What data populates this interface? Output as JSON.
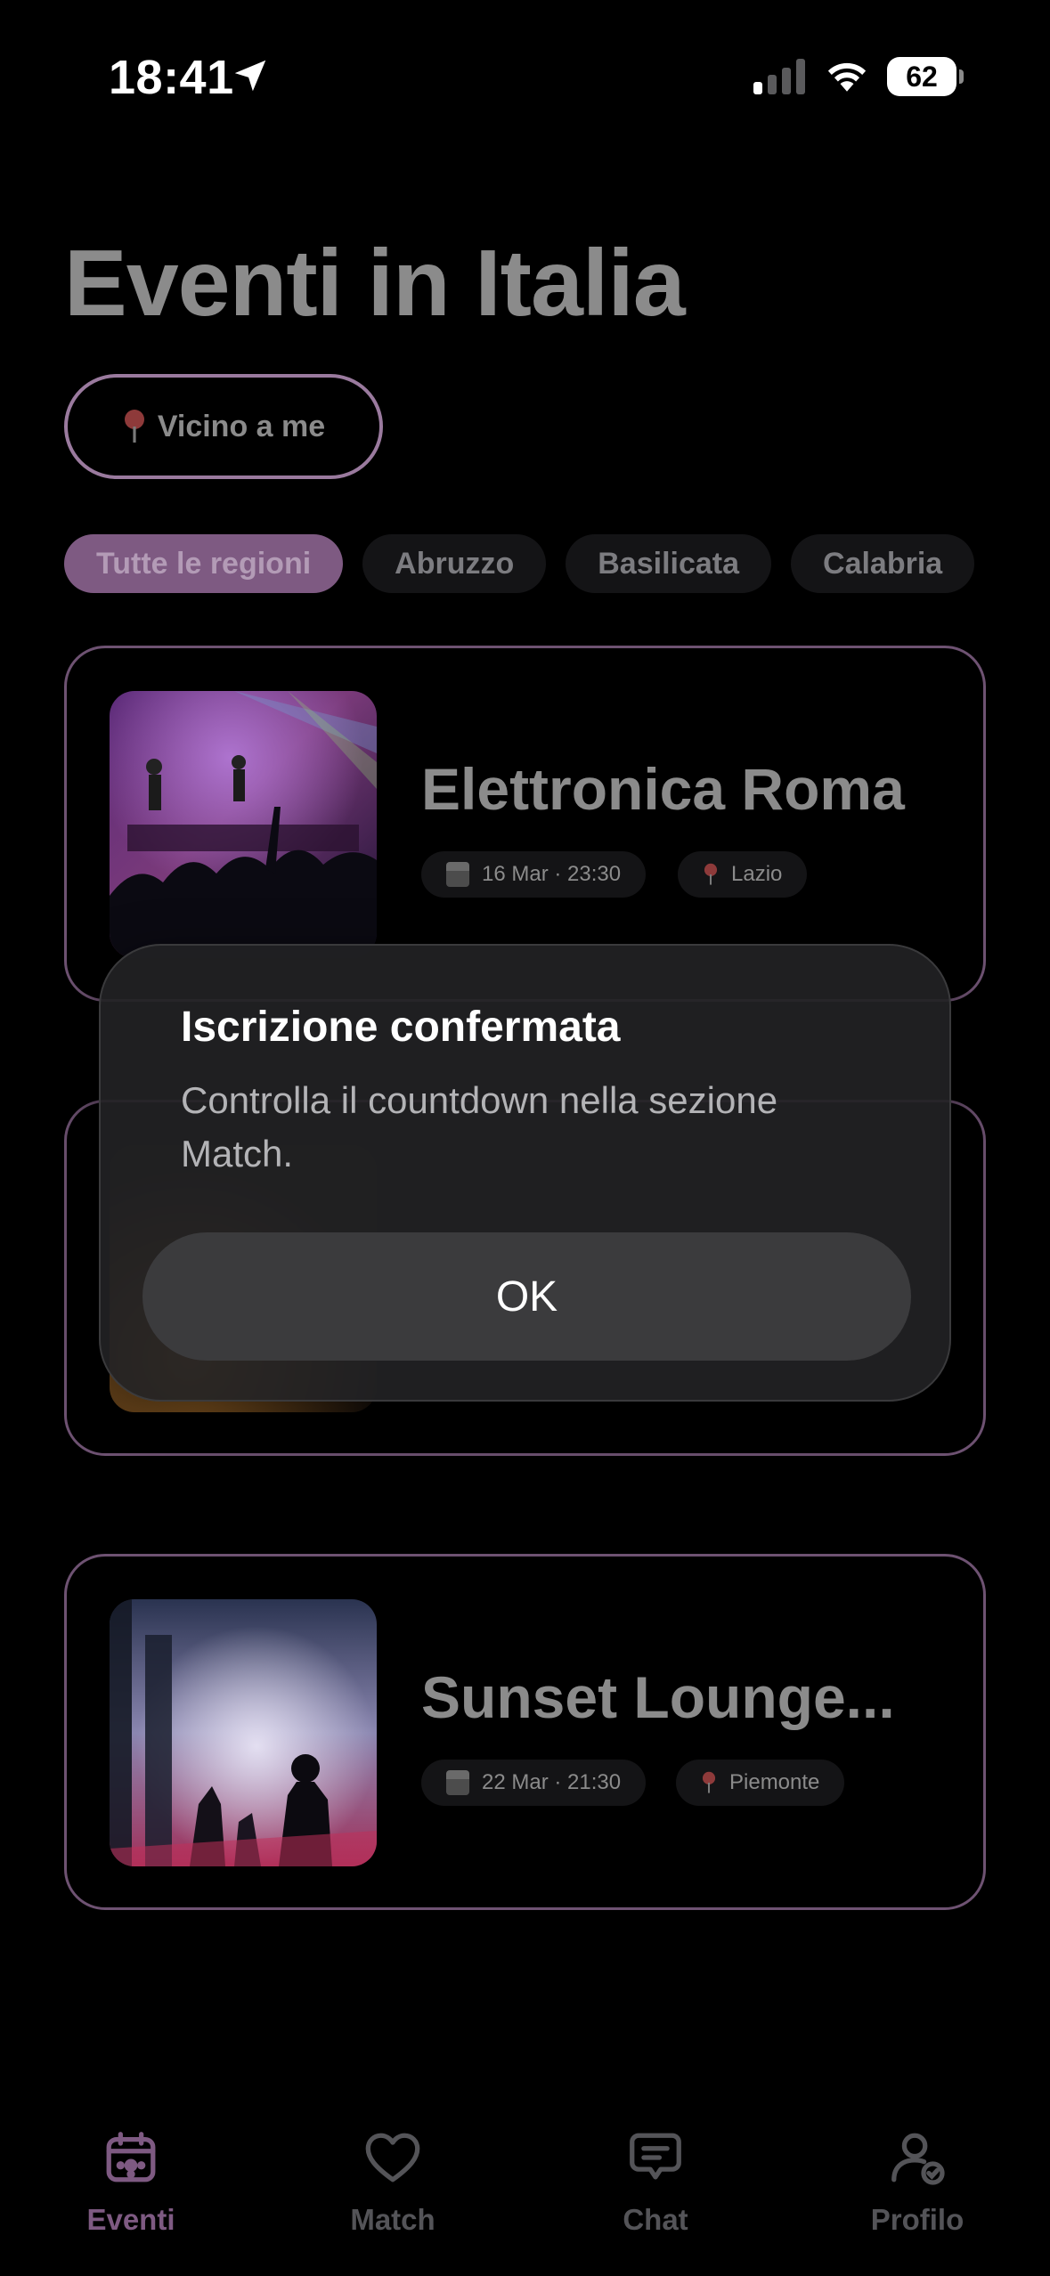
{
  "status_bar": {
    "time": "18:41",
    "battery": "62"
  },
  "header": {
    "title": "Eventi in Italia",
    "near_me_label": "Vicino a me"
  },
  "region_chips": [
    {
      "label": "Tutte le regioni",
      "active": true
    },
    {
      "label": "Abruzzo",
      "active": false
    },
    {
      "label": "Basilicata",
      "active": false
    },
    {
      "label": "Calabria",
      "active": false
    }
  ],
  "events": [
    {
      "title": "Elettronica Roma",
      "datetime": "16 Mar · 23:30",
      "region": "Lazio"
    },
    {
      "title": "Sunset Lounge...",
      "datetime": "22 Mar · 21:30",
      "region": "Piemonte"
    }
  ],
  "alert": {
    "title": "Iscrizione confermata",
    "message": "Controlla il countdown nella sezione Match.",
    "ok_label": "OK"
  },
  "tabs": [
    {
      "label": "Eventi",
      "icon": "calendar-icon",
      "active": true
    },
    {
      "label": "Match",
      "icon": "heart-icon",
      "active": false
    },
    {
      "label": "Chat",
      "icon": "chat-icon",
      "active": false
    },
    {
      "label": "Profilo",
      "icon": "profile-icon",
      "active": false
    }
  ],
  "colors": {
    "accent": "#7e5a82",
    "card_border": "#6e5272",
    "background": "#000000"
  }
}
